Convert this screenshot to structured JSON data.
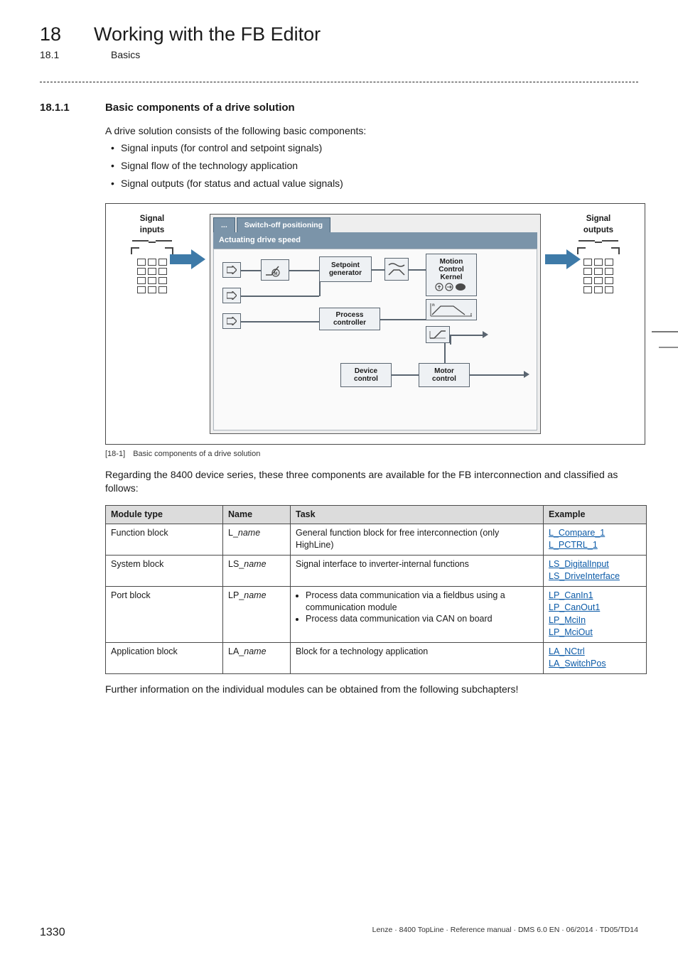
{
  "header": {
    "chapter_num": "18",
    "chapter_title": "Working with the FB Editor",
    "section_num": "18.1",
    "section_title": "Basics"
  },
  "section": {
    "num": "18.1.1",
    "title": "Basic components of a drive solution"
  },
  "intro_para": "A drive solution consists of the following basic components:",
  "intro_bullets": [
    "Signal inputs (for control and setpoint signals)",
    "Signal flow of the technology application",
    "Signal outputs (for status and actual value signals)"
  ],
  "figure": {
    "signal_inputs_l1": "Signal",
    "signal_inputs_l2": "inputs",
    "signal_outputs_l1": "Signal",
    "signal_outputs_l2": "outputs",
    "tab_dots": "...",
    "tab_switchoff": "Switch-off positioning",
    "strip_label": "Actuating drive speed",
    "node_setpoint_l1": "Setpoint",
    "node_setpoint_l2": "generator",
    "node_process_l1": "Process",
    "node_process_l2": "controller",
    "node_device_l1": "Device",
    "node_device_l2": "control",
    "node_motor_l1": "Motor",
    "node_motor_l2": "control",
    "node_mck_l1": "Motion",
    "node_mck_l2": "Control",
    "node_mck_l3": "Kernel",
    "motor_letter": "M",
    "caption_tag": "[18-1]",
    "caption_text": "Basic components of a drive solution"
  },
  "para_after_fig": "Regarding the 8400 device series, these three components are available for the FB interconnection and classified as follows:",
  "table": {
    "headers": {
      "c1": "Module type",
      "c2": "Name",
      "c3": "Task",
      "c4": "Example"
    },
    "rows": [
      {
        "type": "Function block",
        "name_prefix": "L_",
        "name_ital": "name",
        "task_plain": "General function block for free interconnection (only HighLine)",
        "examples": [
          "L_Compare_1",
          "L_PCTRL_1"
        ]
      },
      {
        "type": "System block",
        "name_prefix": "LS_",
        "name_ital": "name",
        "task_plain": "Signal interface to inverter-internal functions",
        "examples": [
          "LS_DigitalInput",
          "LS_DriveInterface"
        ]
      },
      {
        "type": "Port block",
        "name_prefix": "LP_",
        "name_ital": "name",
        "task_bullets": [
          "Process data communication via a fieldbus using a communication module",
          "Process data communication via CAN on board"
        ],
        "examples": [
          "LP_CanIn1",
          "LP_CanOut1",
          "LP_MciIn",
          "LP_MciOut"
        ]
      },
      {
        "type": "Application block",
        "name_prefix": "LA_",
        "name_ital": "name",
        "task_plain": "Block for a technology application",
        "examples": [
          "LA_NCtrl",
          "LA_SwitchPos"
        ]
      }
    ]
  },
  "closing_para": "Further information on the individual modules can be obtained from the following subchapters!",
  "footer": {
    "page": "1330",
    "meta": "Lenze · 8400 TopLine · Reference manual · DMS 6.0 EN · 06/2014 · TD05/TD14"
  }
}
